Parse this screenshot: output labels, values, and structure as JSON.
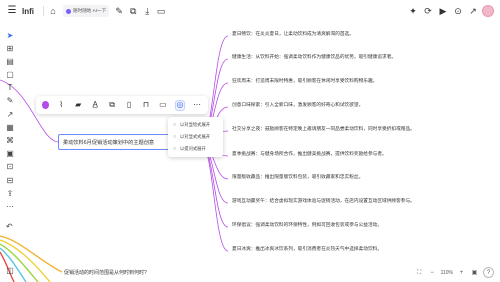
{
  "header": {
    "app_title": "Infi",
    "ai_chip_label": "随时随地 AI一下",
    "icons": [
      "menu-icon",
      "home-icon",
      "edit-icon",
      "copy-icon",
      "download-icon",
      "folder-icon",
      "magic-icon",
      "sync-icon",
      "play-icon",
      "pin-icon",
      "share-icon",
      "avatar"
    ]
  },
  "mindmap": {
    "center_text": "柔动饮料6月促销活动策划中的主题创意",
    "branches": [
      "夏日畅饮：在炎炎夏日，让柔动饮料成为清爽解渴的首选。",
      "健康生活：从饮料开始：强调柔动饮料作为健康饮品的优势，吸引健康追求者。",
      "狂欢周末：打造周末限时特惠，吸引顾客在休闲时享受饮料购物乐趣。",
      "创意口味探索：引入全新口味，激发顾客的好奇心和试饮欲望。",
      "社交分享之夜：鼓励顾客在特定晚上邀请朋友一同品尝柔动饮料，同时享受折扣或赠品。",
      "夏季挑战赛：与健身场所合作，推出健美挑战赛，提供饮料奖励给参与者。",
      "限量版收藏品：推出限量版饮料包装，吸引收藏家和忠实粉丝。",
      "游戏互动赢奖午：结合虚拟现实游戏体验与促销活动，在店内设置互动区域供顾客参与。",
      "环保倡议：强调柔动饮料的环保特性，例如可回收包装或参与公益活动。",
      "夏日冰爽：推出冰爽冰饮系列，吸引消费者在炎热天气中选择柔动饮料。"
    ],
    "bottom_node": "促销活动的时间范围是从何时到何时?"
  },
  "float_toolbar": {
    "icons": [
      "color-picker",
      "attach-icon",
      "paint-icon",
      "text-style-icon",
      "copy-icon",
      "delete-icon",
      "lock-icon",
      "comment-icon",
      "ai-assist-icon",
      "more-icon"
    ],
    "branch_color": "#b44ce8"
  },
  "ai_menu": {
    "items": [
      "以对显绘式展开",
      "以对显式式展开",
      "以提问式展开"
    ]
  },
  "zoom": {
    "level": "110%"
  },
  "colors": {
    "accent": "#3a6cf4",
    "branch": "#b44ce8",
    "selection": "#6b8cff"
  }
}
